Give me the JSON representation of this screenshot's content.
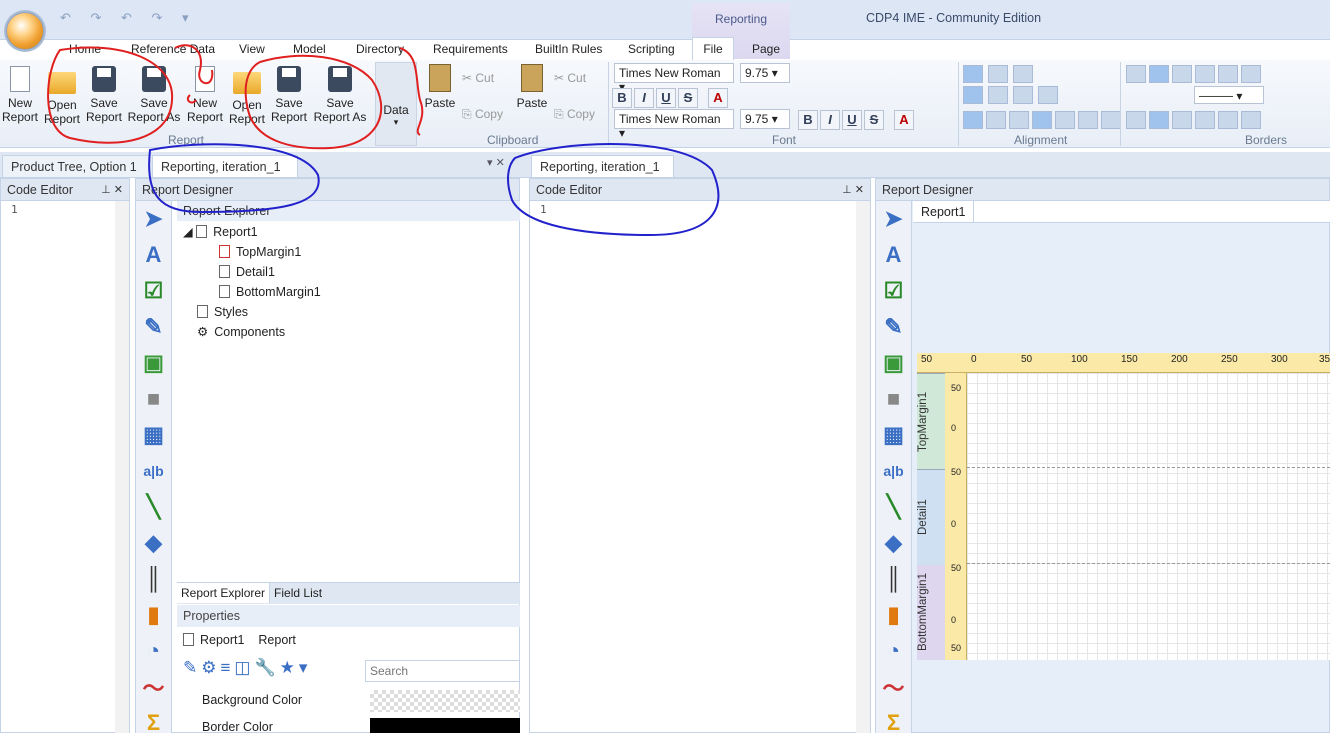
{
  "window": {
    "title": "CDP4 IME - Community Edition",
    "context_tab": "Reporting"
  },
  "ribbon_tabs": [
    "Home",
    "Reference Data",
    "View",
    "Model",
    "Directory",
    "Requirements",
    "BuiltIn Rules",
    "Scripting",
    "File",
    "Page"
  ],
  "report_group": {
    "label": "Report",
    "buttons": [
      {
        "l1": "New",
        "l2": "Report"
      },
      {
        "l1": "Open",
        "l2": "Report"
      },
      {
        "l1": "Save",
        "l2": "Report"
      },
      {
        "l1": "Save",
        "l2": "Report As"
      },
      {
        "l1": "New",
        "l2": "Report"
      },
      {
        "l1": "Open",
        "l2": "Report"
      },
      {
        "l1": "Save",
        "l2": "Report"
      },
      {
        "l1": "Save",
        "l2": "Report As"
      }
    ],
    "data_label": "Data"
  },
  "clipboard": {
    "label": "Clipboard",
    "paste": "Paste",
    "cut": "Cut",
    "copy": "Copy"
  },
  "font": {
    "label": "Font",
    "family": "Times New Roman",
    "size": "9.75",
    "b": "B",
    "i": "I",
    "u": "U",
    "s": "S",
    "a": "A"
  },
  "alignment": {
    "label": "Alignment"
  },
  "borders": {
    "label": "Borders"
  },
  "doc_tabs_left": [
    "Product Tree, Option 1",
    "Reporting, iteration_1"
  ],
  "doc_tabs_right": [
    "Reporting, iteration_1"
  ],
  "left": {
    "code_editor": "Code Editor",
    "line1": "1",
    "report_designer": "Report Designer",
    "explorer_title": "Report Explorer",
    "tree": {
      "root": "Report1",
      "children": [
        "TopMargin1",
        "Detail1",
        "BottomMargin1"
      ],
      "styles": "Styles",
      "components": "Components"
    },
    "bottom_tabs": [
      "Report Explorer",
      "Field List"
    ],
    "properties": "Properties",
    "prop_obj": "Report1",
    "prop_type": "Report",
    "search_placeholder": "Search",
    "props": [
      "Background Color",
      "Border Color"
    ]
  },
  "right": {
    "code_editor": "Code Editor",
    "line1": "1",
    "report_designer": "Report Designer",
    "report_tab": "Report1",
    "ruler_labels": [
      "50",
      "0",
      "50",
      "100",
      "150",
      "200",
      "250",
      "300",
      "35"
    ],
    "bands": [
      "TopMargin1",
      "Detail1",
      "BottomMargin1"
    ],
    "band_nums": [
      "50",
      "0",
      "50",
      "0",
      "50",
      "0",
      "50"
    ]
  },
  "colors": {
    "accent": "#3b6fc4",
    "annot_red": "#e02020",
    "annot_blue": "#2222cc"
  }
}
